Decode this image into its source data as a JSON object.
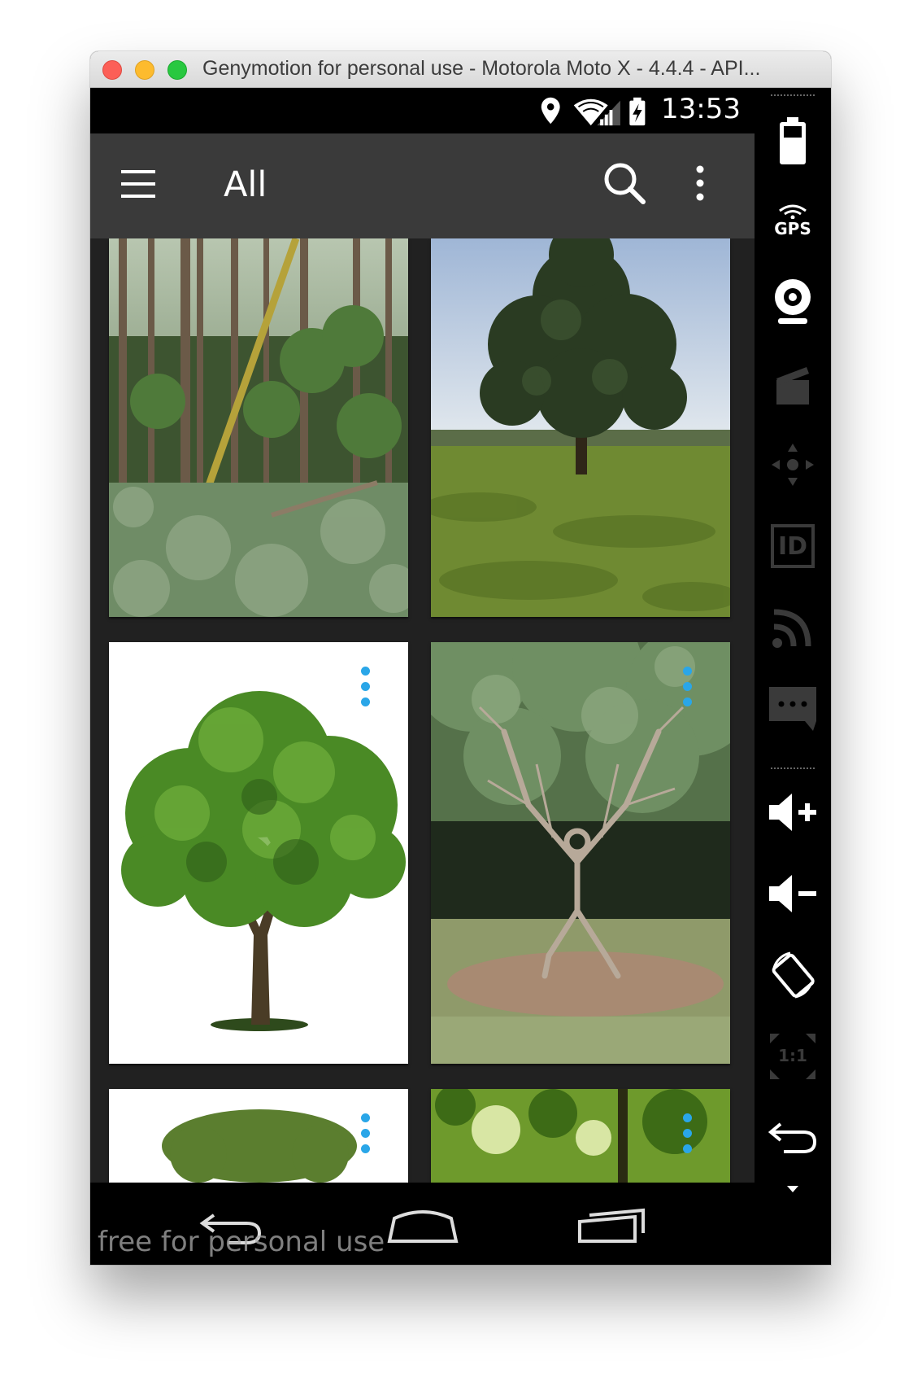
{
  "window": {
    "title": "Genymotion for personal use - Motorola Moto X - 4.4.4 - API..."
  },
  "status_bar": {
    "time": "13:53"
  },
  "app_bar": {
    "title": "All"
  },
  "watermark": "free for personal use",
  "side_toolbar": {
    "gps_label": "GPS",
    "id_label": "ID",
    "pixel_ratio_label": "1:1"
  },
  "colors": {
    "app_bar": "#3a3a3a",
    "content_bg": "#212121",
    "accent_dots": "#2aa6e8"
  }
}
